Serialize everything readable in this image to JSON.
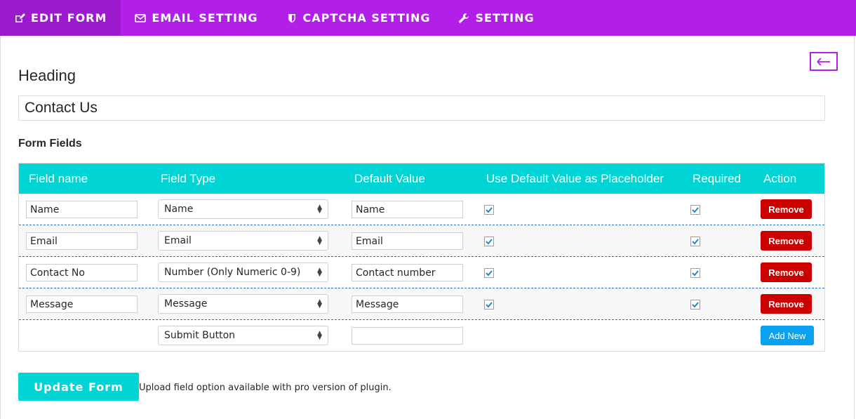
{
  "tabs": [
    {
      "label": "EDIT FORM",
      "icon": "edit-icon",
      "active": true
    },
    {
      "label": "EMAIL SETTING",
      "icon": "envelope-icon"
    },
    {
      "label": "CAPTCHA SETTING",
      "icon": "shield-icon"
    },
    {
      "label": "SETTING",
      "icon": "wrench-icon"
    }
  ],
  "colors": {
    "accent": "#b11fe8",
    "table_header": "#00d4d4",
    "remove": "#cc0000",
    "add": "#0aa1f0"
  },
  "heading": {
    "label": "Heading",
    "value": "Contact Us"
  },
  "form_fields": {
    "title": "Form Fields",
    "columns": [
      "Field name",
      "Field Type",
      "Default Value",
      "Use Default Value as Placeholder",
      "Required",
      "Action"
    ],
    "rows": [
      {
        "name": "Name",
        "type": "Name",
        "default": "Name",
        "placeholder": true,
        "required": true,
        "action": "Remove"
      },
      {
        "name": "Email",
        "type": "Email",
        "default": "Email",
        "placeholder": true,
        "required": true,
        "action": "Remove"
      },
      {
        "name": "Contact No",
        "type": "Number (Only Numeric 0-9)",
        "default": "Contact number",
        "placeholder": true,
        "required": true,
        "action": "Remove"
      },
      {
        "name": "Message",
        "type": "Message",
        "default": "Message",
        "placeholder": true,
        "required": true,
        "action": "Remove"
      }
    ],
    "new_row": {
      "type": "Submit Button",
      "default": "",
      "action": "Add New"
    }
  },
  "footer": {
    "update_label": "Update Form",
    "note": "Upload field option available with pro version of plugin."
  }
}
